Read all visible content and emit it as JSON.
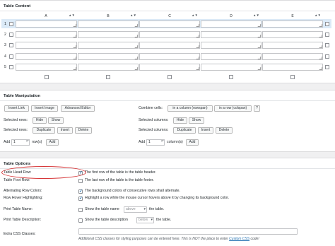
{
  "table_content": {
    "title": "Table Content",
    "columns": [
      "A",
      "B",
      "C",
      "D",
      "E"
    ],
    "sort_icons": "▲▼",
    "rows": [
      "1",
      "2",
      "3",
      "4",
      "5"
    ]
  },
  "table_manipulation": {
    "title": "Table Manipulation",
    "insert_link": "Insert Link",
    "insert_image": "Insert Image",
    "advanced_editor": "Advanced Editor",
    "combine_cells_label": "Combine cells:",
    "rowspan_button": "in a column (rowspan)",
    "colspan_button": "in a row (colspan)",
    "help_button": "?",
    "selected_rows_label": "Selected rows:",
    "selected_columns_label": "Selected columns:",
    "hide": "Hide",
    "show": "Show",
    "duplicate": "Duplicate",
    "insert": "Insert",
    "delete": "Delete",
    "add_label": "Add",
    "add_rows_value": "1",
    "rows_suffix": "row(s)",
    "add_cols_value": "1",
    "cols_suffix": "column(s)",
    "add_button": "Add"
  },
  "table_options": {
    "title": "Table Options",
    "head_row_label": "Table Head Row:",
    "head_row_text": "The first row of the table is the table header.",
    "head_row_checked": true,
    "foot_row_label": "Table Foot Row:",
    "foot_row_text": "The last row of the table is the table footer.",
    "foot_row_checked": false,
    "alt_colors_label": "Alternating Row Colors:",
    "alt_colors_text": "The background colors of consecutive rows shall alternate.",
    "alt_colors_checked": true,
    "hover_label": "Row Hover Highlighting:",
    "hover_text": "Highlight a row while the mouse cursor hovers above it by changing its background color.",
    "hover_checked": true,
    "print_name_label": "Print Table Name:",
    "print_name_text": "Show the table name",
    "print_name_select": "above",
    "print_name_suffix": "the table.",
    "print_name_checked": false,
    "print_desc_label": "Print Table Description:",
    "print_desc_text": "Show the table description",
    "print_desc_select": "below",
    "print_desc_suffix": "the table.",
    "print_desc_checked": false,
    "extra_css_label": "Extra CSS Classes:",
    "extra_css_value": "",
    "extra_css_help_prefix": "Additional CSS classes for styling purposes can be entered here. This is NOT the place to enter",
    "extra_css_help_link": "Custom CSS",
    "extra_css_help_suffix": "code!"
  },
  "colors": {
    "accent": "#2271b1",
    "highlight_row": "#dbeaf7",
    "annotation": "#d63638"
  }
}
